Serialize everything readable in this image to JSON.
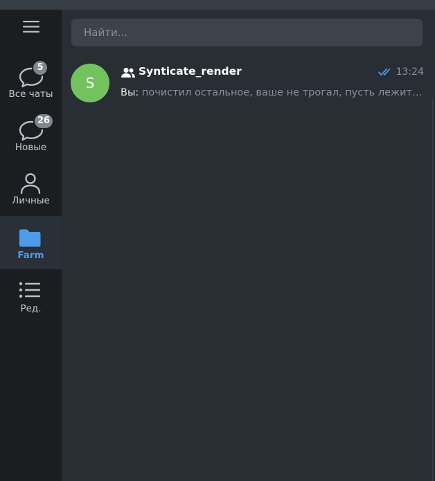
{
  "sidebar": {
    "menu_icon": "hamburger-icon",
    "folders": [
      {
        "label": "Все чаты",
        "icon": "chats-icon",
        "badge": "5"
      },
      {
        "label": "Новые",
        "icon": "chats-icon",
        "badge": "26"
      },
      {
        "label": "Личные",
        "icon": "person-icon"
      },
      {
        "label": "Farm",
        "icon": "folder-icon",
        "active": true
      },
      {
        "label": "Ред.",
        "icon": "edit-list-icon"
      }
    ]
  },
  "search": {
    "placeholder": "Найти..."
  },
  "chats": [
    {
      "avatar_letter": "S",
      "avatar_color": "#72c35e",
      "name": "Synticate_render",
      "time": "13:24",
      "read_status": "double-check-icon",
      "sender": "Вы:",
      "preview": "почистил остальное, ваше не трогал, пусть лежит ..."
    }
  ],
  "colors": {
    "accent": "#4e9bea",
    "sidebar_bg": "#1b1d21",
    "main_bg": "#282e33"
  }
}
